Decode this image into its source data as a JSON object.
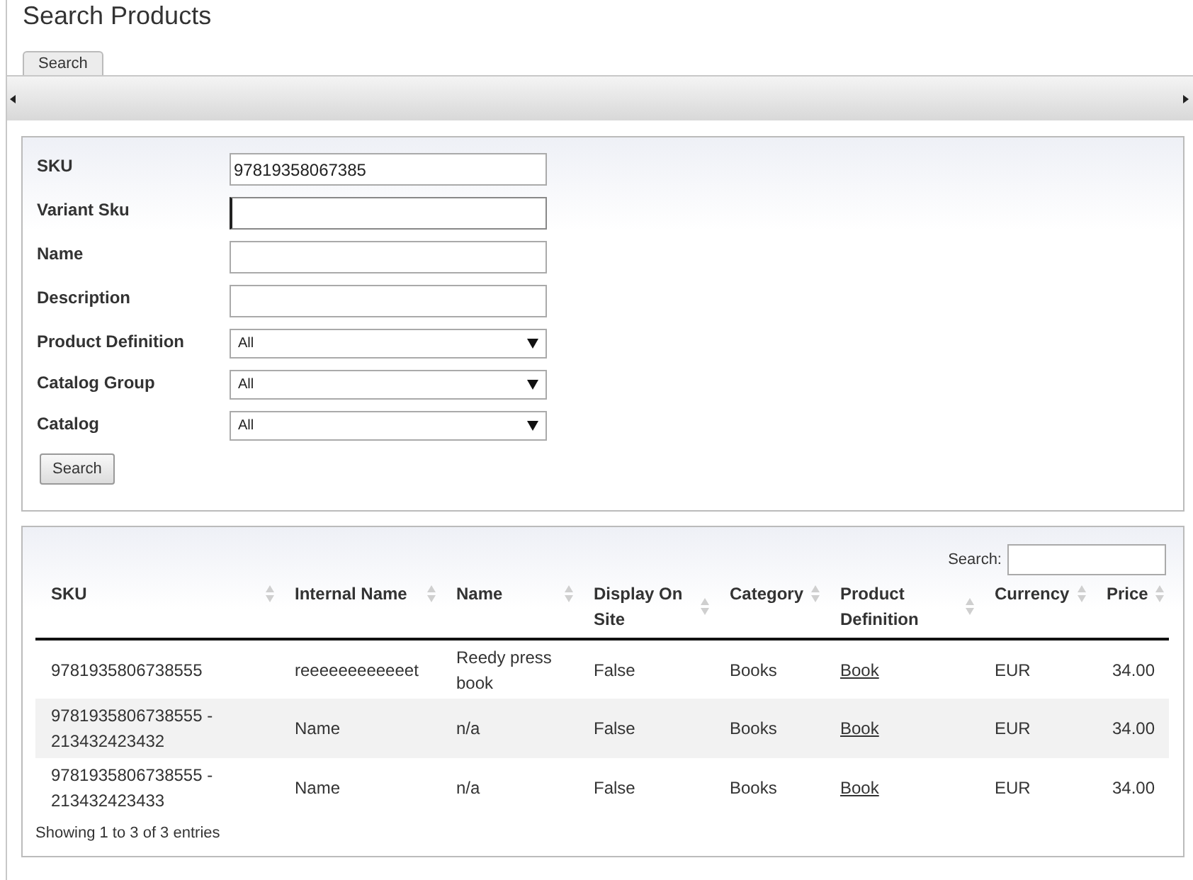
{
  "page_title": "Search Products",
  "tabs": [
    {
      "label": "Search",
      "selected": true
    }
  ],
  "form": {
    "fields": [
      {
        "label": "SKU",
        "kind": "text",
        "value": "97819358067385",
        "focused": false
      },
      {
        "label": "Variant Sku",
        "kind": "text",
        "focused": true
      },
      {
        "label": "Name",
        "kind": "text",
        "focused": false
      },
      {
        "label": "Description",
        "kind": "text",
        "focused": false
      },
      {
        "label": "Product Definition",
        "kind": "select",
        "value": "All",
        "focused": false
      },
      {
        "label": "Catalog Group",
        "kind": "select",
        "value": "All",
        "focused": false
      },
      {
        "label": "Catalog",
        "kind": "select",
        "value": "All",
        "focused": false
      }
    ],
    "button": "Search"
  },
  "table": {
    "search_label": "Search:",
    "columns": [
      "SKU",
      "Internal Name",
      "Name",
      "Display On Site",
      "Category",
      "Product Definition",
      "Currency",
      "Price"
    ],
    "rows": [
      [
        "9781935806738555",
        "reeeeeeeeeeeet",
        "Reedy press book",
        "False",
        "Books",
        "Book",
        "EUR",
        "34.00"
      ],
      [
        "9781935806738555 - 213432423432",
        "Name",
        "n/a",
        "False",
        "Books",
        "Book",
        "EUR",
        "34.00"
      ],
      [
        "9781935806738555 - 213432423433",
        "Name",
        "n/a",
        "False",
        "Books",
        "Book",
        "EUR",
        "34.00"
      ]
    ],
    "info": "Showing 1 to 3 of 3 entries"
  }
}
